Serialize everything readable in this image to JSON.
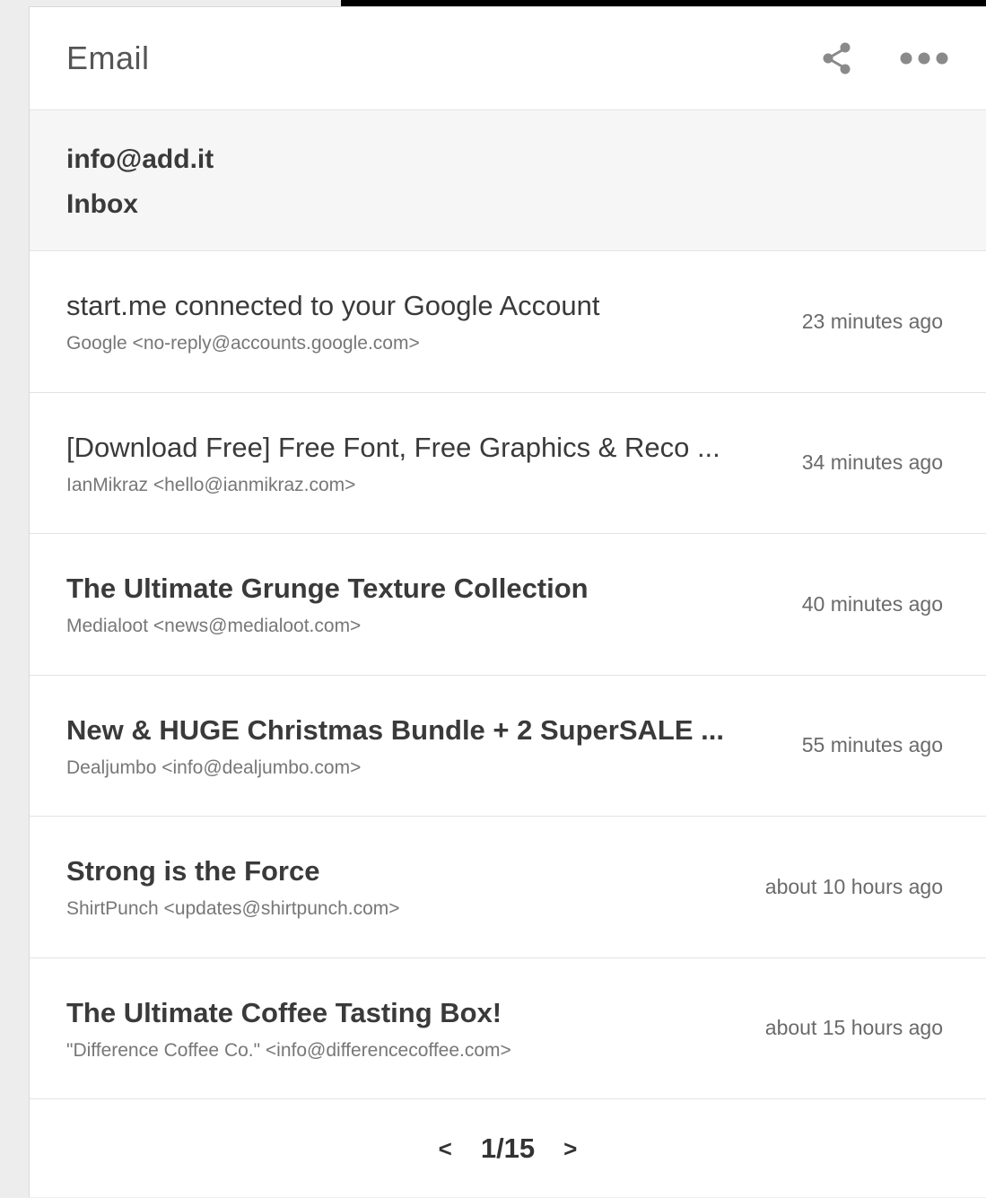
{
  "widget": {
    "title": "Email",
    "share_icon": "share-icon",
    "more_icon": "more-dots-icon"
  },
  "account": {
    "address": "info@add.it",
    "folder": "Inbox"
  },
  "emails": [
    {
      "subject": "start.me connected to your Google Account",
      "from": "Google <no-reply@accounts.google.com>",
      "time": "23 minutes ago",
      "unread": false
    },
    {
      "subject": "[Download Free] Free Font, Free Graphics & Reco ...",
      "from": "IanMikraz <hello@ianmikraz.com>",
      "time": "34 minutes ago",
      "unread": false
    },
    {
      "subject": "The Ultimate Grunge Texture Collection",
      "from": "Medialoot <news@medialoot.com>",
      "time": "40 minutes ago",
      "unread": true
    },
    {
      "subject": "New & HUGE Christmas Bundle + 2 SuperSALE ...",
      "from": "Dealjumbo <info@dealjumbo.com>",
      "time": "55 minutes ago",
      "unread": true
    },
    {
      "subject": "Strong is the Force",
      "from": "ShirtPunch <updates@shirtpunch.com>",
      "time": "about 10 hours ago",
      "unread": true
    },
    {
      "subject": "The Ultimate Coffee Tasting Box!",
      "from": "\"Difference Coffee Co.\" <info@differencecoffee.com>",
      "time": "about 15 hours ago",
      "unread": true
    }
  ],
  "pager": {
    "prev": "<",
    "label": "1/15",
    "next": ">"
  }
}
